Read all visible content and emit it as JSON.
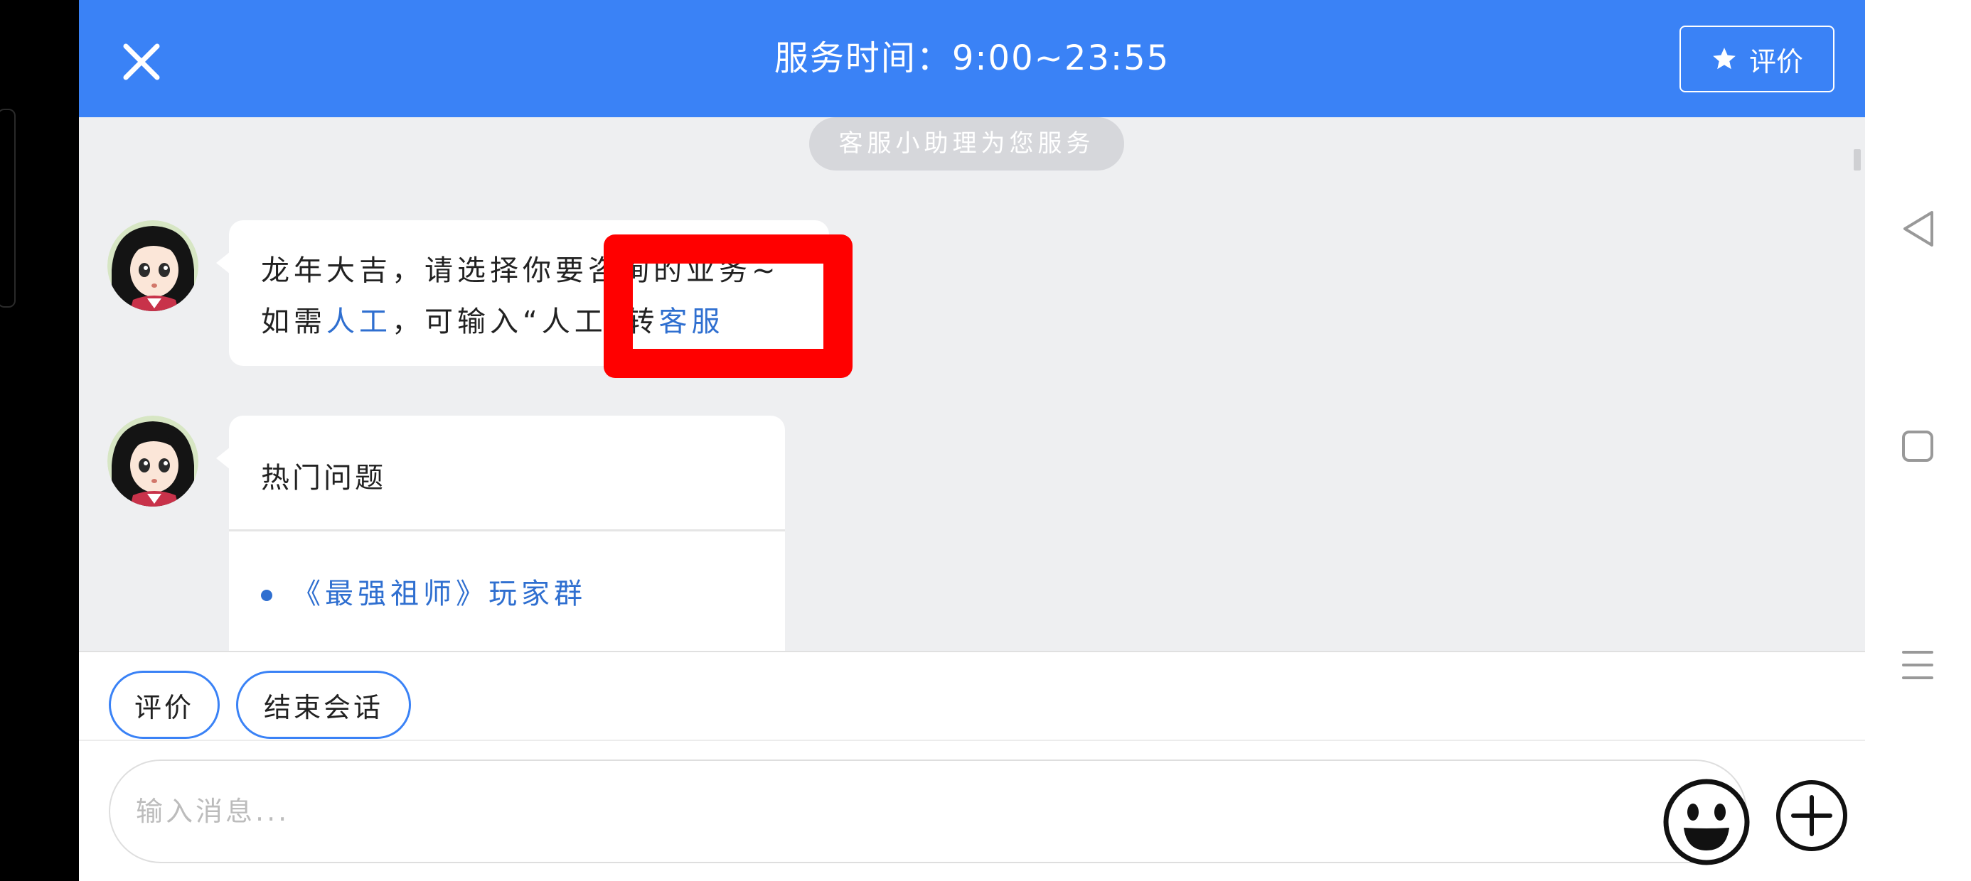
{
  "header": {
    "title": "服务时间：9:00~23:55",
    "rate_label": "评价"
  },
  "chat": {
    "system_notice": "客服小助理为您服务",
    "greeting": {
      "line1": "龙年大吉，请选择你要咨询的业务~",
      "line2_prefix": "如需",
      "line2_link1": "人工",
      "line2_middle": "，可输入“人工”转",
      "line2_link2": "客服"
    },
    "hot": {
      "title": "热门问题",
      "items": [
        "《最强祖师》玩家群"
      ]
    }
  },
  "quick_actions": {
    "rate_label": "评价",
    "end_label": "结束会话"
  },
  "input": {
    "placeholder": "输入消息..."
  },
  "colors": {
    "accent": "#3a82f6",
    "link": "#2f6fd0",
    "highlight": "#ff0000"
  },
  "icons": [
    "close-icon",
    "star-icon",
    "emoji-icon",
    "plus-icon",
    "back-icon",
    "home-icon",
    "menu-icon"
  ]
}
